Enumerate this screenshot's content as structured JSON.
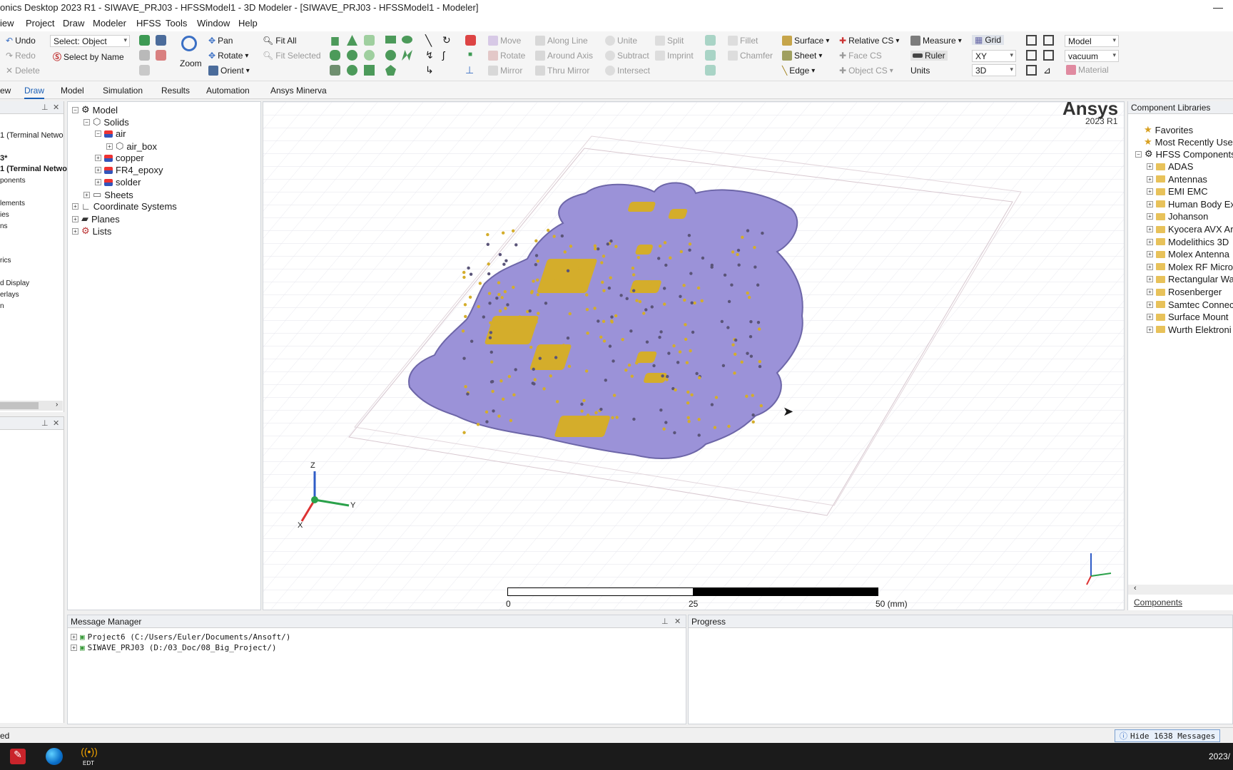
{
  "window": {
    "title": "onics Desktop 2023 R1 - SIWAVE_PRJ03 - HFSSModel1 - 3D Modeler - [SIWAVE_PRJ03 - HFSSModel1 - Modeler]",
    "minimize": "—"
  },
  "menu": [
    "iew",
    "Project",
    "Draw",
    "Modeler",
    "HFSS",
    "Tools",
    "Window",
    "Help"
  ],
  "ribbon": {
    "undo": "Undo",
    "redo": "Redo",
    "delete": "Delete",
    "select_object": "Select: Object",
    "select_by_name": "Select by Name",
    "zoom": "Zoom",
    "pan": "Pan",
    "rotate": "Rotate",
    "orient": "Orient",
    "fit_all": "Fit All",
    "fit_selected": "Fit Selected",
    "move": "Move",
    "rotate2": "Rotate",
    "mirror": "Mirror",
    "along_line": "Along Line",
    "around_axis": "Around Axis",
    "thru_mirror": "Thru Mirror",
    "unite": "Unite",
    "subtract": "Subtract",
    "intersect": "Intersect",
    "split": "Split",
    "imprint": "Imprint",
    "fillet": "Fillet",
    "chamfer": "Chamfer",
    "surface": "Surface",
    "sheet": "Sheet",
    "edge": "Edge",
    "relative_cs": "Relative CS",
    "face_cs": "Face CS",
    "object_cs": "Object CS",
    "measure": "Measure",
    "ruler": "Ruler",
    "units": "Units",
    "grid": "Grid",
    "plane": "XY",
    "mode": "3D",
    "model": "Model",
    "material_value": "vacuum",
    "material": "Material"
  },
  "tabs": [
    "ew",
    "Draw",
    "Model",
    "Simulation",
    "Results",
    "Automation",
    "Ansys Minerva"
  ],
  "left_partial": {
    "items": [
      "1 (Terminal Netwo",
      "3*",
      "1 (Terminal Netwo",
      "ponents",
      "lements",
      "ies",
      "ns",
      "rics",
      "d Display",
      "erlays",
      "n"
    ]
  },
  "tree": {
    "model": "Model",
    "solids": "Solids",
    "air": "air",
    "air_box": "air_box",
    "copper": "copper",
    "fr4": "FR4_epoxy",
    "solder": "solder",
    "sheets": "Sheets",
    "coord": "Coordinate Systems",
    "planes": "Planes",
    "lists": "Lists"
  },
  "viewport": {
    "brand": "Ansys",
    "version": "2023 R1",
    "scale_labels": [
      "0",
      "25",
      "50 (mm)"
    ],
    "axes": {
      "z": "Z",
      "y": "Y",
      "x": "X"
    }
  },
  "component_libraries": {
    "title": "Component Libraries",
    "favorites": "Favorites",
    "recent": "Most Recently Use",
    "hfss": "HFSS Components",
    "items": [
      "ADAS",
      "Antennas",
      "EMI EMC",
      "Human Body Ex",
      "Johanson",
      "Kyocera AVX Ar",
      "Modelithics 3D",
      "Molex Antenna",
      "Molex RF Micro",
      "Rectangular Wa",
      "Rosenberger",
      "Samtec Connec",
      "Surface Mount",
      "Wurth Elektroni"
    ],
    "tab": "Components"
  },
  "message_manager": {
    "title": "Message Manager",
    "rows": [
      "Project6 (C:/Users/Euler/Documents/Ansoft/)",
      "SIWAVE_PRJ03 (D:/03_Doc/08_Big_Project/)"
    ]
  },
  "progress": {
    "title": "Progress"
  },
  "status": {
    "left": "ed",
    "hide_messages": "Hide 1638 Messages"
  },
  "taskbar": {
    "edt_label": "EDT",
    "clock": "2023/"
  },
  "colors": {
    "pcb": "#9b92d8",
    "copper": "#d4ad2b",
    "accent": "#1b5fb5"
  }
}
